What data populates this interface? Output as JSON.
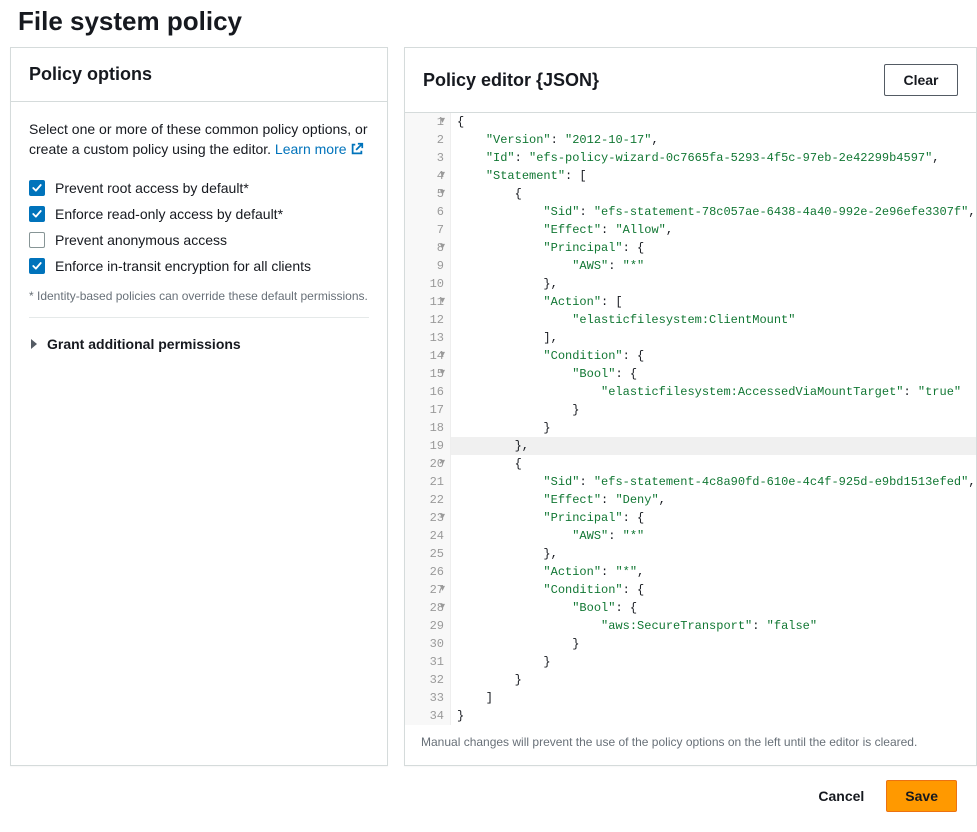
{
  "page": {
    "title": "File system policy"
  },
  "options_panel": {
    "title": "Policy options",
    "description_prefix": "Select one or more of these common policy options, or create a custom policy using the editor. ",
    "learn_more_label": "Learn more",
    "options": [
      {
        "label": "Prevent root access by default*",
        "checked": true
      },
      {
        "label": "Enforce read-only access by default*",
        "checked": true
      },
      {
        "label": "Prevent anonymous access",
        "checked": false
      },
      {
        "label": "Enforce in-transit encryption for all clients",
        "checked": true
      }
    ],
    "footnote": "* Identity-based policies can override these default permissions.",
    "grant_additional": "Grant additional permissions"
  },
  "editor_panel": {
    "title": "Policy editor {JSON}",
    "clear_label": "Clear",
    "note": "Manual changes will prevent the use of the policy options on the left until the editor is cleared.",
    "highlight_line": 19,
    "lines": [
      {
        "n": 1,
        "fold": true,
        "text": "{"
      },
      {
        "n": 2,
        "fold": false,
        "text": "    \"Version\": \"2012-10-17\","
      },
      {
        "n": 3,
        "fold": false,
        "text": "    \"Id\": \"efs-policy-wizard-0c7665fa-5293-4f5c-97eb-2e42299b4597\","
      },
      {
        "n": 4,
        "fold": true,
        "text": "    \"Statement\": ["
      },
      {
        "n": 5,
        "fold": true,
        "text": "        {"
      },
      {
        "n": 6,
        "fold": false,
        "text": "            \"Sid\": \"efs-statement-78c057ae-6438-4a40-992e-2e96efe3307f\","
      },
      {
        "n": 7,
        "fold": false,
        "text": "            \"Effect\": \"Allow\","
      },
      {
        "n": 8,
        "fold": true,
        "text": "            \"Principal\": {"
      },
      {
        "n": 9,
        "fold": false,
        "text": "                \"AWS\": \"*\""
      },
      {
        "n": 10,
        "fold": false,
        "text": "            },"
      },
      {
        "n": 11,
        "fold": true,
        "text": "            \"Action\": ["
      },
      {
        "n": 12,
        "fold": false,
        "text": "                \"elasticfilesystem:ClientMount\""
      },
      {
        "n": 13,
        "fold": false,
        "text": "            ],"
      },
      {
        "n": 14,
        "fold": true,
        "text": "            \"Condition\": {"
      },
      {
        "n": 15,
        "fold": true,
        "text": "                \"Bool\": {"
      },
      {
        "n": 16,
        "fold": false,
        "text": "                    \"elasticfilesystem:AccessedViaMountTarget\": \"true\""
      },
      {
        "n": 17,
        "fold": false,
        "text": "                }"
      },
      {
        "n": 18,
        "fold": false,
        "text": "            }"
      },
      {
        "n": 19,
        "fold": false,
        "text": "        },"
      },
      {
        "n": 20,
        "fold": true,
        "text": "        {"
      },
      {
        "n": 21,
        "fold": false,
        "text": "            \"Sid\": \"efs-statement-4c8a90fd-610e-4c4f-925d-e9bd1513efed\","
      },
      {
        "n": 22,
        "fold": false,
        "text": "            \"Effect\": \"Deny\","
      },
      {
        "n": 23,
        "fold": true,
        "text": "            \"Principal\": {"
      },
      {
        "n": 24,
        "fold": false,
        "text": "                \"AWS\": \"*\""
      },
      {
        "n": 25,
        "fold": false,
        "text": "            },"
      },
      {
        "n": 26,
        "fold": false,
        "text": "            \"Action\": \"*\","
      },
      {
        "n": 27,
        "fold": true,
        "text": "            \"Condition\": {"
      },
      {
        "n": 28,
        "fold": true,
        "text": "                \"Bool\": {"
      },
      {
        "n": 29,
        "fold": false,
        "text": "                    \"aws:SecureTransport\": \"false\""
      },
      {
        "n": 30,
        "fold": false,
        "text": "                }"
      },
      {
        "n": 31,
        "fold": false,
        "text": "            }"
      },
      {
        "n": 32,
        "fold": false,
        "text": "        }"
      },
      {
        "n": 33,
        "fold": false,
        "text": "    ]"
      },
      {
        "n": 34,
        "fold": false,
        "text": "}"
      }
    ]
  },
  "footer": {
    "cancel_label": "Cancel",
    "save_label": "Save"
  }
}
